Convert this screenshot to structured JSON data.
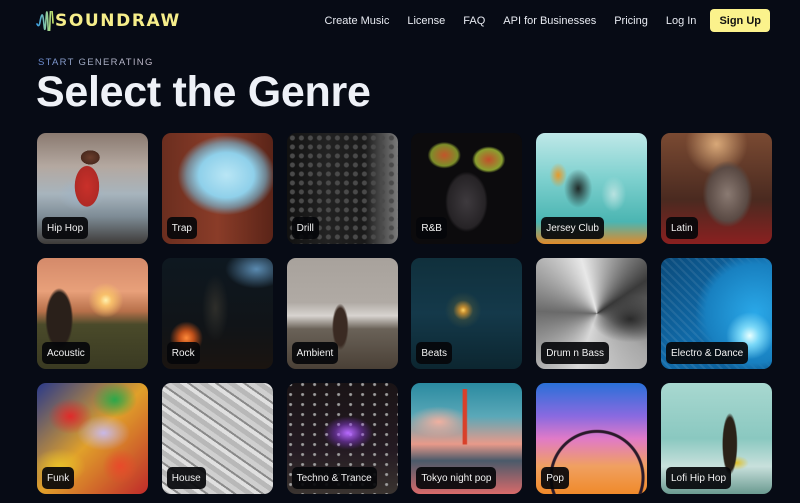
{
  "header": {
    "logo_text": "SOUNDRAW",
    "nav": [
      {
        "label": "Create Music"
      },
      {
        "label": "License"
      },
      {
        "label": "FAQ"
      },
      {
        "label": "API for Businesses"
      },
      {
        "label": "Pricing"
      },
      {
        "label": "Log In"
      }
    ],
    "signup_label": "Sign Up",
    "accent_color": "#fbf28c"
  },
  "hero": {
    "eyebrow": "START GENERATING",
    "title": "Select the Genre"
  },
  "genres": [
    {
      "label": "Hip Hop",
      "image": "person in red hoodie and denim jacket by car"
    },
    {
      "label": "Trap",
      "image": "blue smoke cloud over face"
    },
    {
      "label": "Drill",
      "image": "black and white bandana shirt with chains"
    },
    {
      "label": "R&B",
      "image": "woman with flowers in hair, dark background"
    },
    {
      "label": "Jersey Club",
      "image": "group of friends at party, teal lighting"
    },
    {
      "label": "Latin",
      "image": "singer with microphone, warm lighting"
    },
    {
      "label": "Acoustic",
      "image": "guitarist silhouette at sunset in field"
    },
    {
      "label": "Rock",
      "image": "musician on dark stage with blue light"
    },
    {
      "label": "Ambient",
      "image": "woman on misty mountain landscape"
    },
    {
      "label": "Beats",
      "image": "foggy night street with lamp"
    },
    {
      "label": "Drum n Bass",
      "image": "abstract gray swirl"
    },
    {
      "label": "Electro & Dance",
      "image": "blue disco ball"
    },
    {
      "label": "Funk",
      "image": "colorful paint strokes"
    },
    {
      "label": "House",
      "image": "gray textured paint strokes"
    },
    {
      "label": "Techno & Trance",
      "image": "purple heart drone show over crowd"
    },
    {
      "label": "Tokyo night pop",
      "image": "Tokyo tower city street at dusk"
    },
    {
      "label": "Pop",
      "image": "ferris wheel silhouette against gradient sky"
    },
    {
      "label": "Lofi Hip Hop",
      "image": "man in teal room with plant"
    }
  ]
}
